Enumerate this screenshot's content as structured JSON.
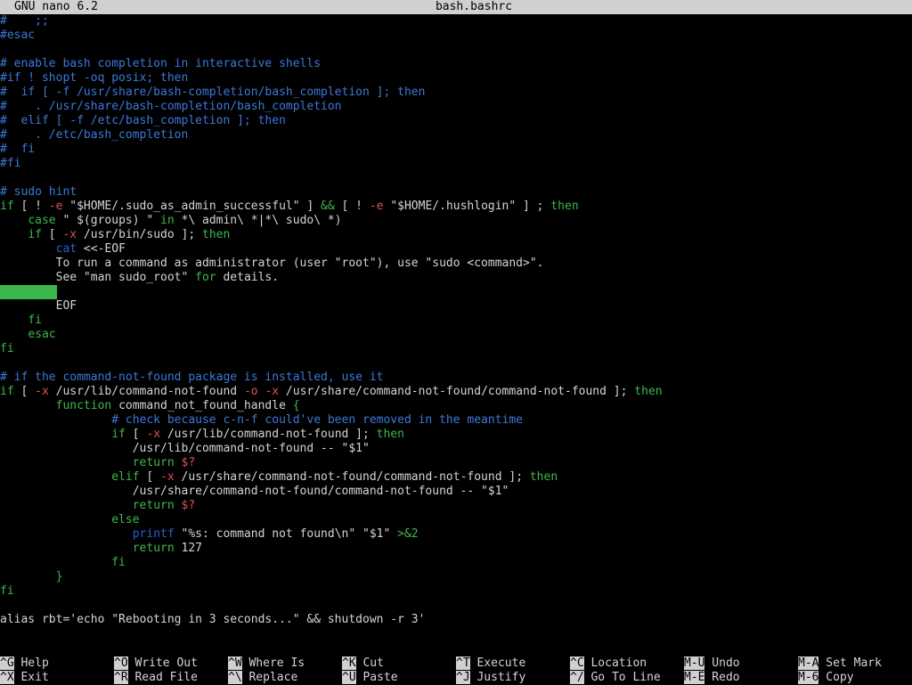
{
  "window": {
    "app_title": "GNU nano 6.2",
    "file_title": "bash.bashrc"
  },
  "colors": {
    "comment": "#3c78d8",
    "keyword": "#3cb84a",
    "string": "#d4d4d4",
    "builtin": "#2a5fd0",
    "variable": "#e05050",
    "text": "#d4d4d4",
    "cursor": "#3cb84a",
    "titlebar_bg": "#d0d0d0"
  },
  "editor": {
    "lines": [
      [
        {
          "t": "#    ;;",
          "c": "comment"
        }
      ],
      [
        {
          "t": "#esac",
          "c": "comment"
        }
      ],
      [],
      [
        {
          "t": "# enable bash completion in interactive shells",
          "c": "comment"
        }
      ],
      [
        {
          "t": "#if ! shopt -oq posix; then",
          "c": "comment"
        }
      ],
      [
        {
          "t": "#  if [ -f /usr/share/bash-completion/bash_completion ]; then",
          "c": "comment"
        }
      ],
      [
        {
          "t": "#    . /usr/share/bash-completion/bash_completion",
          "c": "comment"
        }
      ],
      [
        {
          "t": "#  elif [ -f /etc/bash_completion ]; then",
          "c": "comment"
        }
      ],
      [
        {
          "t": "#    . /etc/bash_completion",
          "c": "comment"
        }
      ],
      [
        {
          "t": "#  fi",
          "c": "comment"
        }
      ],
      [
        {
          "t": "#fi",
          "c": "comment"
        }
      ],
      [],
      [
        {
          "t": "# sudo hint",
          "c": "comment"
        }
      ],
      [
        {
          "t": "if",
          "c": "keyword"
        },
        {
          "t": " [ ! ",
          "c": "text"
        },
        {
          "t": "-e",
          "c": "variable"
        },
        {
          "t": " \"$HOME/.sudo_as_admin_successful\" ] ",
          "c": "text"
        },
        {
          "t": "&&",
          "c": "keyword"
        },
        {
          "t": " [ ! ",
          "c": "text"
        },
        {
          "t": "-e",
          "c": "variable"
        },
        {
          "t": " \"$HOME/.hushlogin\" ] ; ",
          "c": "text"
        },
        {
          "t": "then",
          "c": "keyword"
        }
      ],
      [
        {
          "t": "    ",
          "c": "text"
        },
        {
          "t": "case",
          "c": "keyword"
        },
        {
          "t": " \" $(groups) \" ",
          "c": "text"
        },
        {
          "t": "in",
          "c": "keyword"
        },
        {
          "t": " *\\ admin\\ *|*\\ sudo\\ *)",
          "c": "text"
        }
      ],
      [
        {
          "t": "    ",
          "c": "text"
        },
        {
          "t": "if",
          "c": "keyword"
        },
        {
          "t": " [ ",
          "c": "text"
        },
        {
          "t": "-x",
          "c": "variable"
        },
        {
          "t": " /usr/bin/sudo ]; ",
          "c": "text"
        },
        {
          "t": "then",
          "c": "keyword"
        }
      ],
      [
        {
          "t": "        ",
          "c": "text"
        },
        {
          "t": "cat",
          "c": "builtin"
        },
        {
          "t": " <<-EOF",
          "c": "text"
        }
      ],
      [
        {
          "t": "        To run a command as administrator (user \"root\"), use \"sudo <command>\".",
          "c": "text"
        }
      ],
      [
        {
          "t": "        See \"man sudo_root\" ",
          "c": "text"
        },
        {
          "t": "for",
          "c": "keyword"
        },
        {
          "t": " details.",
          "c": "text"
        }
      ],
      [],
      [
        {
          "t": "        EOF",
          "c": "text"
        }
      ],
      [
        {
          "t": "    ",
          "c": "text"
        },
        {
          "t": "fi",
          "c": "keyword"
        }
      ],
      [
        {
          "t": "    ",
          "c": "text"
        },
        {
          "t": "esac",
          "c": "keyword"
        }
      ],
      [
        {
          "t": "fi",
          "c": "keyword"
        }
      ],
      [],
      [
        {
          "t": "# if the command-not-found package is installed, use it",
          "c": "comment"
        }
      ],
      [
        {
          "t": "if",
          "c": "keyword"
        },
        {
          "t": " [ ",
          "c": "text"
        },
        {
          "t": "-x",
          "c": "variable"
        },
        {
          "t": " /usr/lib/command-not-found ",
          "c": "text"
        },
        {
          "t": "-o",
          "c": "variable"
        },
        {
          "t": " ",
          "c": "text"
        },
        {
          "t": "-x",
          "c": "variable"
        },
        {
          "t": " /usr/share/command-not-found/command-not-found ]; ",
          "c": "text"
        },
        {
          "t": "then",
          "c": "keyword"
        }
      ],
      [
        {
          "t": "        ",
          "c": "text"
        },
        {
          "t": "function",
          "c": "keyword"
        },
        {
          "t": " command_not_found_handle ",
          "c": "text"
        },
        {
          "t": "{",
          "c": "keyword"
        }
      ],
      [
        {
          "t": "                # check because c-n-f could've been removed in the meantime",
          "c": "comment"
        }
      ],
      [
        {
          "t": "                ",
          "c": "text"
        },
        {
          "t": "if",
          "c": "keyword"
        },
        {
          "t": " [ ",
          "c": "text"
        },
        {
          "t": "-x",
          "c": "variable"
        },
        {
          "t": " /usr/lib/command-not-found ]; ",
          "c": "text"
        },
        {
          "t": "then",
          "c": "keyword"
        }
      ],
      [
        {
          "t": "                   /usr/lib/command-not-found -- \"$1\"",
          "c": "text"
        }
      ],
      [
        {
          "t": "                   ",
          "c": "text"
        },
        {
          "t": "return",
          "c": "keyword"
        },
        {
          "t": " ",
          "c": "text"
        },
        {
          "t": "$?",
          "c": "variable"
        }
      ],
      [
        {
          "t": "                ",
          "c": "text"
        },
        {
          "t": "elif",
          "c": "keyword"
        },
        {
          "t": " [ ",
          "c": "text"
        },
        {
          "t": "-x",
          "c": "variable"
        },
        {
          "t": " /usr/share/command-not-found/command-not-found ]; ",
          "c": "text"
        },
        {
          "t": "then",
          "c": "keyword"
        }
      ],
      [
        {
          "t": "                   /usr/share/command-not-found/command-not-found -- \"$1\"",
          "c": "text"
        }
      ],
      [
        {
          "t": "                   ",
          "c": "text"
        },
        {
          "t": "return",
          "c": "keyword"
        },
        {
          "t": " ",
          "c": "text"
        },
        {
          "t": "$?",
          "c": "variable"
        }
      ],
      [
        {
          "t": "                ",
          "c": "text"
        },
        {
          "t": "else",
          "c": "keyword"
        }
      ],
      [
        {
          "t": "                   ",
          "c": "text"
        },
        {
          "t": "printf",
          "c": "builtin"
        },
        {
          "t": " \"%s: command not found\\n\" \"$1\" ",
          "c": "text"
        },
        {
          "t": ">&2",
          "c": "keyword"
        }
      ],
      [
        {
          "t": "                   ",
          "c": "text"
        },
        {
          "t": "return",
          "c": "keyword"
        },
        {
          "t": " 127",
          "c": "text"
        }
      ],
      [
        {
          "t": "                ",
          "c": "text"
        },
        {
          "t": "fi",
          "c": "keyword"
        }
      ],
      [
        {
          "t": "        ",
          "c": "text"
        },
        {
          "t": "}",
          "c": "keyword"
        }
      ],
      [
        {
          "t": "fi",
          "c": "keyword"
        }
      ],
      [],
      [
        {
          "t": "alias rbt='echo \"Rebooting in 3 seconds...\" && shutdown -r 3'",
          "c": "text"
        }
      ]
    ],
    "cursor_line": 19
  },
  "shortcuts": {
    "rows": [
      [
        {
          "key": "^G",
          "label": "Help"
        },
        {
          "key": "^O",
          "label": "Write Out"
        },
        {
          "key": "^W",
          "label": "Where Is"
        },
        {
          "key": "^K",
          "label": "Cut"
        },
        {
          "key": "^T",
          "label": "Execute"
        },
        {
          "key": "^C",
          "label": "Location"
        },
        {
          "key": "M-U",
          "label": "Undo"
        },
        {
          "key": "M-A",
          "label": "Set Mark"
        }
      ],
      [
        {
          "key": "^X",
          "label": "Exit"
        },
        {
          "key": "^R",
          "label": "Read File"
        },
        {
          "key": "^\\",
          "label": "Replace"
        },
        {
          "key": "^U",
          "label": "Paste"
        },
        {
          "key": "^J",
          "label": "Justify"
        },
        {
          "key": "^/",
          "label": "Go To Line"
        },
        {
          "key": "M-E",
          "label": "Redo"
        },
        {
          "key": "M-6",
          "label": "Copy"
        }
      ]
    ]
  }
}
